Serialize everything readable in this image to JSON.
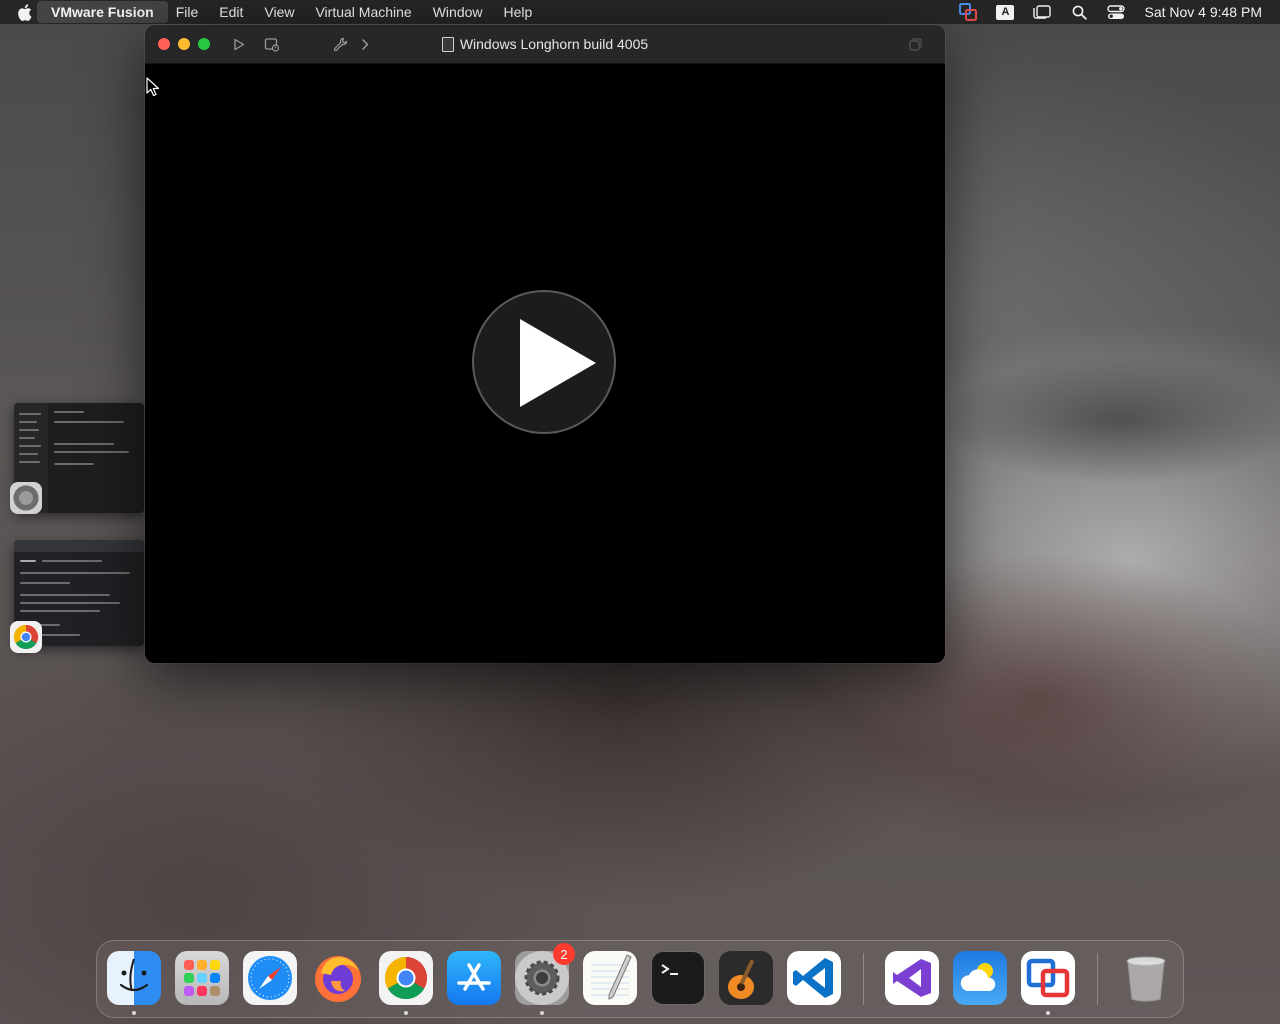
{
  "menubar": {
    "app_name": "VMware Fusion",
    "menus": [
      "File",
      "Edit",
      "View",
      "Virtual Machine",
      "Window",
      "Help"
    ],
    "input_source": "A",
    "clock": "Sat Nov 4  9:48 PM"
  },
  "window": {
    "title": "Windows Longhorn build 4005",
    "state": "powered-off"
  },
  "dock": {
    "settings_badge": "2",
    "apps": [
      "Finder",
      "Launchpad",
      "Safari",
      "Firefox",
      "Google Chrome",
      "App Store",
      "System Settings",
      "TextEdit",
      "Terminal",
      "GarageBand",
      "Visual Studio Code",
      "Visual Studio",
      "Weather",
      "VMware Fusion",
      "Trash"
    ]
  },
  "colors": {
    "close": "#ff5f57",
    "minimize": "#febc2e",
    "zoom": "#28c840",
    "badge": "#ff3b30"
  }
}
